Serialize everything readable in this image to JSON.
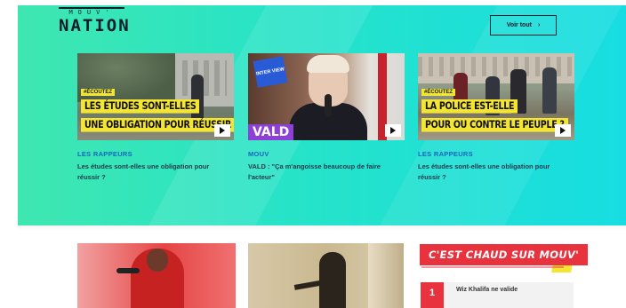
{
  "brand": {
    "logo_small": "MOUV'",
    "logo_big": "NATION"
  },
  "header": {
    "see_all_label": "Voir tout"
  },
  "cards": [
    {
      "hashtag": "#ÉCOUTEZ",
      "headline_line1": "LES ÉTUDES SONT-ELLES",
      "headline_line2": "UNE OBLIGATION POUR RÉUSSIR ?",
      "category": "LES RAPPEURS",
      "description": "Les études sont-elles une obligation pour réussir ?"
    },
    {
      "badge": "INTER VIEW",
      "overlay_name": "VALD",
      "category": "MOUV",
      "description": "VALD : \"Ça m'angoisse beaucoup de faire l'acteur\""
    },
    {
      "hashtag": "#ÉCOUTEZ",
      "headline_line1": "LA POLICE EST-ELLE",
      "headline_line2": "POUR OU CONTRE LE PEUPLE ?",
      "category": "LES RAPPEURS",
      "description": "Les études sont-elles une obligation pour réussir ?"
    }
  ],
  "trending": {
    "title": "C'EST CHAUD SUR MOUV'",
    "items": [
      {
        "rank": "1",
        "text": "Wiz Khalifa ne valide"
      }
    ]
  },
  "colors": {
    "hero_start": "#3fe7b0",
    "hero_end": "#17dde2",
    "category_blue": "#1565c0",
    "highlight_yellow": "#f4e533",
    "accent_red": "#e8333f",
    "vald_purple": "#8e3fd6"
  }
}
